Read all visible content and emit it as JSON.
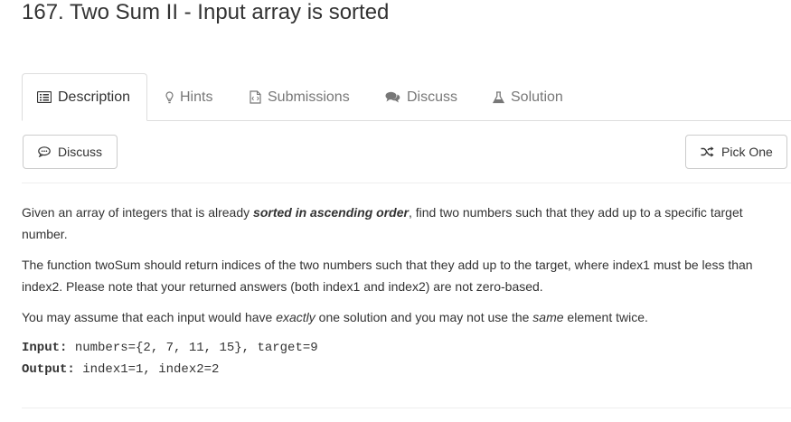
{
  "problem": {
    "title": "167. Two Sum II - Input array is sorted"
  },
  "tabs": [
    {
      "label": "Description",
      "icon": "list-icon",
      "active": true
    },
    {
      "label": "Hints",
      "icon": "lightbulb-icon",
      "active": false
    },
    {
      "label": "Submissions",
      "icon": "code-file-icon",
      "active": false
    },
    {
      "label": "Discuss",
      "icon": "comments-icon",
      "active": false
    },
    {
      "label": "Solution",
      "icon": "flask-icon",
      "active": false
    }
  ],
  "toolbar": {
    "discuss_label": "Discuss",
    "pick_one_label": "Pick One"
  },
  "description": {
    "p1_before": "Given an array of integers that is already ",
    "p1_bold": "sorted in ascending order",
    "p1_after": ", find two numbers such that they add up to a specific target number.",
    "p2": "The function twoSum should return indices of the two numbers such that they add up to the target, where index1 must be less than index2. Please note that your returned answers (both index1 and index2) are not zero-based.",
    "p3_before": "You may assume that each input would have ",
    "p3_em1": "exactly",
    "p3_middle": " one solution and you may not use the ",
    "p3_em2": "same",
    "p3_after": " element twice."
  },
  "example": {
    "input_label": "Input:",
    "input_value": " numbers={2, 7, 11, 15}, target=9",
    "output_label": "Output:",
    "output_value": " index1=1, index2=2"
  }
}
